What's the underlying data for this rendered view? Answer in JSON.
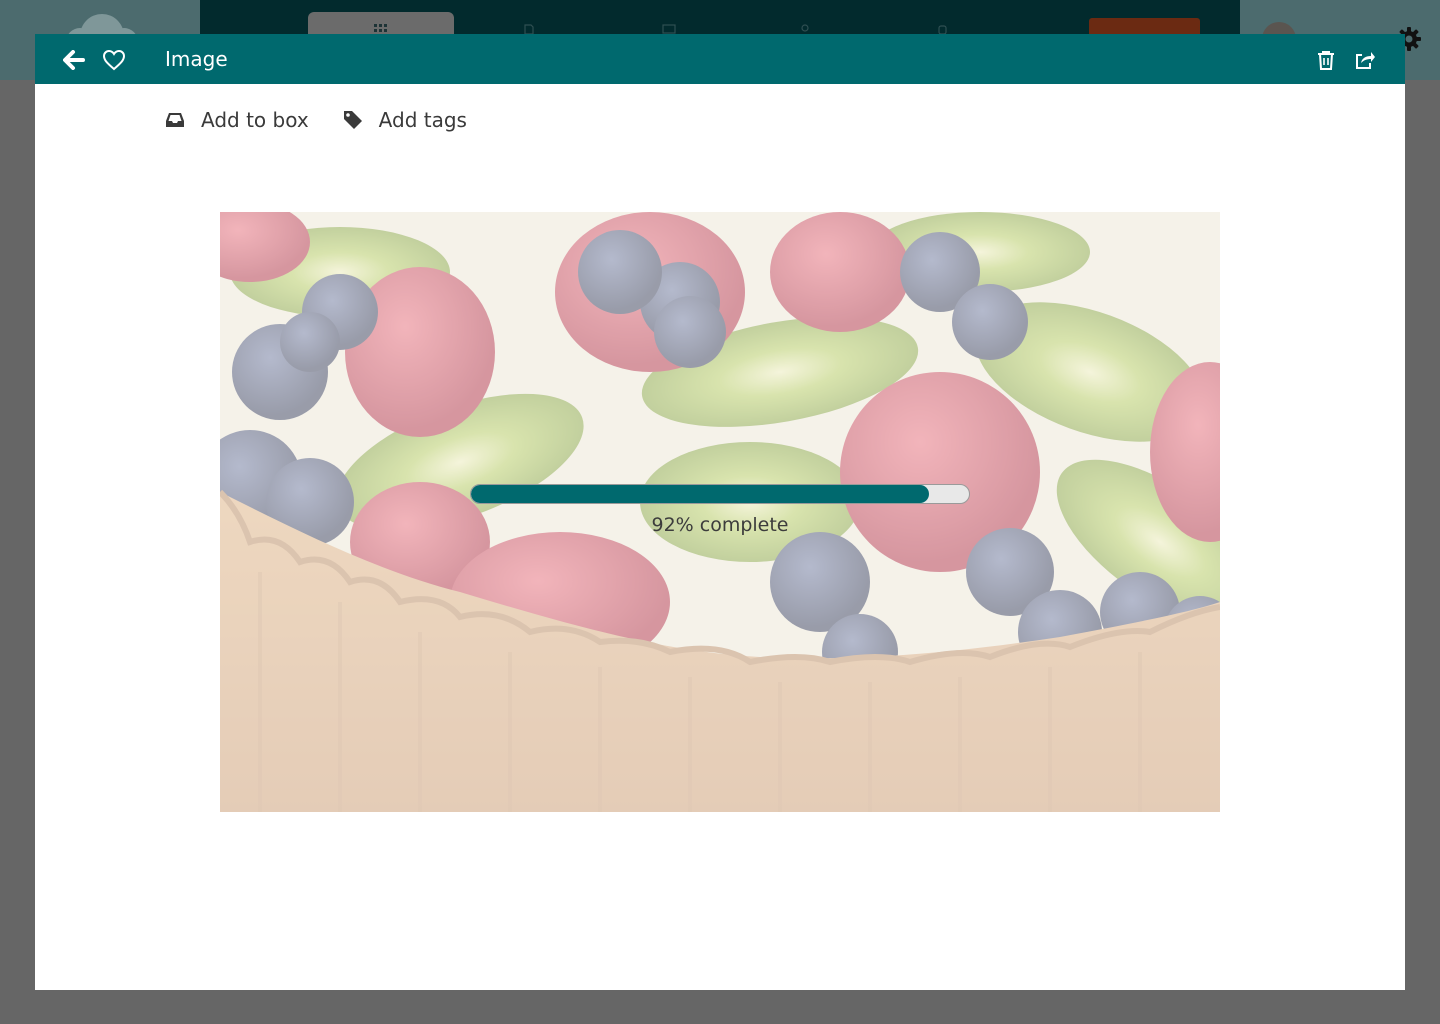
{
  "modal": {
    "title": "Image",
    "toolbar": {
      "add_to_box_label": "Add to box",
      "add_tags_label": "Add tags"
    },
    "upload": {
      "progress": 0.92,
      "progress_text": "92% complete"
    }
  },
  "icons": {
    "back": "arrow-left-icon",
    "favorite": "heart-icon",
    "delete": "trash-icon",
    "share": "share-icon",
    "box": "inbox-icon",
    "tags": "tag-icon"
  },
  "colors": {
    "header": "#00696e",
    "progress_fill": "#00696e",
    "overlay": "#666666"
  }
}
